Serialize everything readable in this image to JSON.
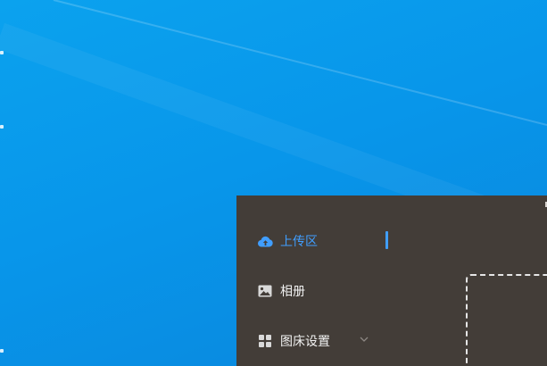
{
  "desktop": {
    "background_color": "#0896ea"
  },
  "app": {
    "background_color": "#433d38",
    "accent_color": "#409eff",
    "menu": {
      "items": [
        {
          "label": "上传区",
          "icon": "cloud-upload-icon",
          "active": true
        },
        {
          "label": "相册",
          "icon": "picture-icon",
          "active": false
        },
        {
          "label": "图床设置",
          "icon": "grid-icon",
          "active": false,
          "expandable": true
        }
      ]
    }
  }
}
